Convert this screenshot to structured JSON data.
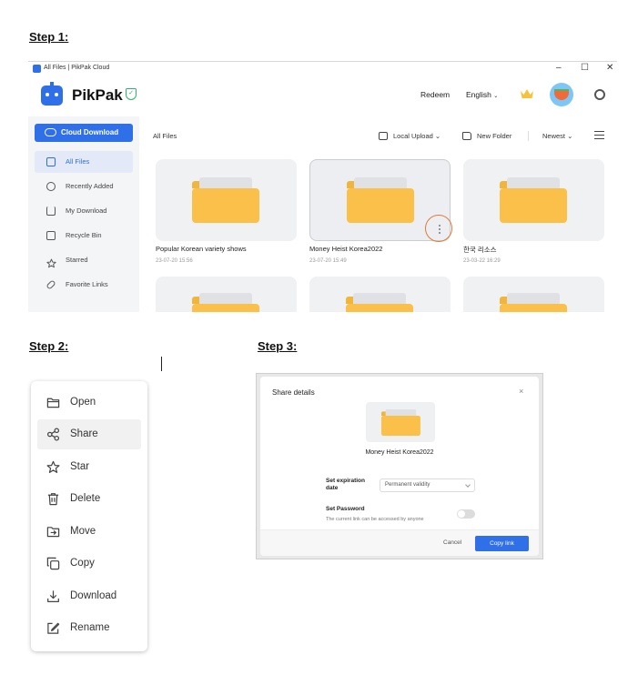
{
  "steps": {
    "step1": "Step 1:",
    "step2": "Step 2:",
    "step3": "Step 3:"
  },
  "window": {
    "title": "All Files | PikPak Cloud",
    "controls": {
      "minimize": "–",
      "maximize": "☐",
      "close": "✕"
    }
  },
  "header": {
    "brand": "PikPak",
    "redeem": "Redeem",
    "language": "English",
    "icons": [
      "shield-check-icon",
      "crown-icon",
      "avatar",
      "gear-icon"
    ]
  },
  "sidebar": {
    "cloud_download": "Cloud Download",
    "items": [
      {
        "label": "All Files",
        "icon": "file-icon"
      },
      {
        "label": "Recently Added",
        "icon": "clock-icon"
      },
      {
        "label": "My Download",
        "icon": "download-icon"
      },
      {
        "label": "Recycle Bin",
        "icon": "trash-icon"
      },
      {
        "label": "Starred",
        "icon": "star-icon"
      },
      {
        "label": "Favorite Links",
        "icon": "link-icon"
      }
    ]
  },
  "toolbar": {
    "title": "All Files",
    "local_upload": "Local Upload",
    "new_folder": "New Folder",
    "sort": "Newest"
  },
  "files": [
    {
      "name": "Popular Korean variety shows",
      "date": "23-07-20 15:56"
    },
    {
      "name": "Money Heist Korea2022",
      "date": "23-07-20 15:49"
    },
    {
      "name": "한국 리소스",
      "date": "23-03-22 16:29"
    }
  ],
  "context_menu": {
    "items": [
      {
        "label": "Open",
        "icon": "folder-open-icon"
      },
      {
        "label": "Share",
        "icon": "share-icon"
      },
      {
        "label": "Star",
        "icon": "star-icon"
      },
      {
        "label": "Delete",
        "icon": "trash-icon"
      },
      {
        "label": "Move",
        "icon": "move-icon"
      },
      {
        "label": "Copy",
        "icon": "copy-icon"
      },
      {
        "label": "Download",
        "icon": "download-icon"
      },
      {
        "label": "Rename",
        "icon": "rename-icon"
      }
    ],
    "highlighted": "Share"
  },
  "share_dialog": {
    "title": "Share details",
    "close": "×",
    "file_name": "Money Heist Korea2022",
    "expiration_label": "Set expiration date",
    "expiration_value": "Permanent validity",
    "password_label": "Set Password",
    "password_sub": "The current link can be accessed by anyone",
    "cancel": "Cancel",
    "copy_link": "Copy link"
  },
  "colors": {
    "accent": "#2f6fe8",
    "folder": "#fbc04a",
    "highlight_ring": "#e07a3a"
  }
}
